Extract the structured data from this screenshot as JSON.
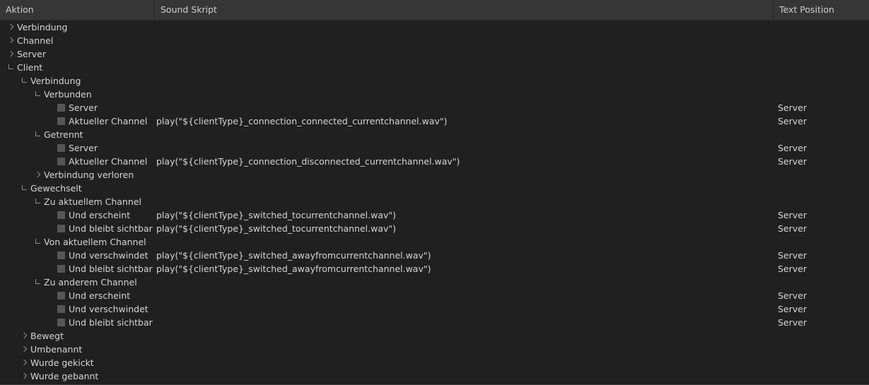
{
  "window": {
    "background": "#202020",
    "header_background": "#363636",
    "text_color": "#d5d5d5",
    "checkbox_color": "#565656"
  },
  "columns": [
    {
      "key": "action",
      "label": "Aktion"
    },
    {
      "key": "script",
      "label": "Sound Skript"
    },
    {
      "key": "textpos",
      "label": "Text Position"
    }
  ],
  "rows": [
    {
      "label": "Verbindung",
      "depth": 0,
      "state": "collapsed",
      "script": "",
      "textpos": ""
    },
    {
      "label": "Channel",
      "depth": 0,
      "state": "collapsed",
      "script": "",
      "textpos": ""
    },
    {
      "label": "Server",
      "depth": 0,
      "state": "collapsed",
      "script": "",
      "textpos": ""
    },
    {
      "label": "Client",
      "depth": 0,
      "state": "expanded",
      "script": "",
      "textpos": ""
    },
    {
      "label": "Verbindung",
      "depth": 1,
      "state": "expanded",
      "script": "",
      "textpos": ""
    },
    {
      "label": "Verbunden",
      "depth": 2,
      "state": "expanded",
      "script": "",
      "textpos": ""
    },
    {
      "label": "Server",
      "depth": 3,
      "state": "checkbox",
      "script": "",
      "textpos": "Server"
    },
    {
      "label": "Aktueller Channel",
      "depth": 3,
      "state": "checkbox",
      "script": "play(\"${clientType}_connection_connected_currentchannel.wav\")",
      "textpos": "Server"
    },
    {
      "label": "Getrennt",
      "depth": 2,
      "state": "expanded",
      "script": "",
      "textpos": ""
    },
    {
      "label": "Server",
      "depth": 3,
      "state": "checkbox",
      "script": "",
      "textpos": "Server"
    },
    {
      "label": "Aktueller Channel",
      "depth": 3,
      "state": "checkbox",
      "script": "play(\"${clientType}_connection_disconnected_currentchannel.wav\")",
      "textpos": "Server"
    },
    {
      "label": "Verbindung verloren",
      "depth": 2,
      "state": "collapsed",
      "script": "",
      "textpos": ""
    },
    {
      "label": "Gewechselt",
      "depth": 1,
      "state": "expanded",
      "script": "",
      "textpos": ""
    },
    {
      "label": "Zu aktuellem Channel",
      "depth": 2,
      "state": "expanded",
      "script": "",
      "textpos": ""
    },
    {
      "label": "Und erscheint",
      "depth": 3,
      "state": "checkbox",
      "script": "play(\"${clientType}_switched_tocurrentchannel.wav\")",
      "textpos": "Server"
    },
    {
      "label": "Und bleibt sichtbar",
      "depth": 3,
      "state": "checkbox",
      "script": "play(\"${clientType}_switched_tocurrentchannel.wav\")",
      "textpos": "Server"
    },
    {
      "label": "Von aktuellem Channel",
      "depth": 2,
      "state": "expanded",
      "script": "",
      "textpos": ""
    },
    {
      "label": "Und verschwindet",
      "depth": 3,
      "state": "checkbox",
      "script": "play(\"${clientType}_switched_awayfromcurrentchannel.wav\")",
      "textpos": "Server"
    },
    {
      "label": "Und bleibt sichtbar",
      "depth": 3,
      "state": "checkbox",
      "script": "play(\"${clientType}_switched_awayfromcurrentchannel.wav\")",
      "textpos": "Server"
    },
    {
      "label": "Zu anderem Channel",
      "depth": 2,
      "state": "expanded",
      "script": "",
      "textpos": ""
    },
    {
      "label": "Und erscheint",
      "depth": 3,
      "state": "checkbox",
      "script": "",
      "textpos": "Server"
    },
    {
      "label": "Und verschwindet",
      "depth": 3,
      "state": "checkbox",
      "script": "",
      "textpos": "Server"
    },
    {
      "label": "Und bleibt sichtbar",
      "depth": 3,
      "state": "checkbox",
      "script": "",
      "textpos": "Server"
    },
    {
      "label": "Bewegt",
      "depth": 1,
      "state": "collapsed",
      "script": "",
      "textpos": ""
    },
    {
      "label": "Umbenannt",
      "depth": 1,
      "state": "collapsed",
      "script": "",
      "textpos": ""
    },
    {
      "label": "Wurde gekickt",
      "depth": 1,
      "state": "collapsed",
      "script": "",
      "textpos": ""
    },
    {
      "label": "Wurde gebannt",
      "depth": 1,
      "state": "collapsed",
      "script": "",
      "textpos": ""
    }
  ]
}
